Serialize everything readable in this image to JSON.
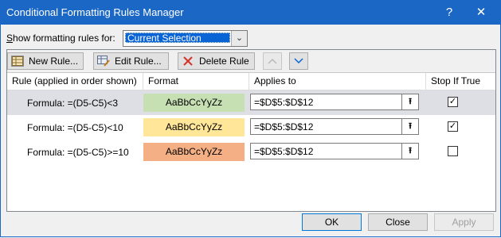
{
  "window": {
    "title": "Conditional Formatting Rules Manager",
    "help_glyph": "?",
    "close_glyph": "✕"
  },
  "show_for": {
    "label_prefix": "",
    "label_underline": "S",
    "label_rest": "how formatting rules for:",
    "selected": "Current Selection"
  },
  "toolbar": {
    "new_label": "New Rule...",
    "new_underline": "N",
    "edit_label": "Edit Rule...",
    "delete_label": "Delete Rule",
    "up_glyph": "︿",
    "down_glyph": "﹀"
  },
  "columns": {
    "rule": "Rule (applied in order shown)",
    "format": "Format",
    "applies_to": "Applies to",
    "stop_if_true": "Stop If True"
  },
  "rules": [
    {
      "rule": "Formula: =(D5-C5)<3",
      "format_sample": "AaBbCcYyZz",
      "format_color": "#c6e0b4",
      "applies_to": "=$D$5:$D$12",
      "stop_if_true": true,
      "selected": true
    },
    {
      "rule": "Formula: =(D5-C5)<10",
      "format_sample": "AaBbCcYyZz",
      "format_color": "#ffe699",
      "applies_to": "=$D$5:$D$12",
      "stop_if_true": true,
      "selected": false
    },
    {
      "rule": "Formula: =(D5-C5)>=10",
      "format_sample": "AaBbCcYyZz",
      "format_color": "#f4b084",
      "applies_to": "=$D$5:$D$12",
      "stop_if_true": false,
      "selected": false
    }
  ],
  "footer": {
    "ok": "OK",
    "close": "Close",
    "apply": "Apply"
  },
  "colors": {
    "title_bar": "#1b67c6",
    "selection": "#0a64d6"
  }
}
